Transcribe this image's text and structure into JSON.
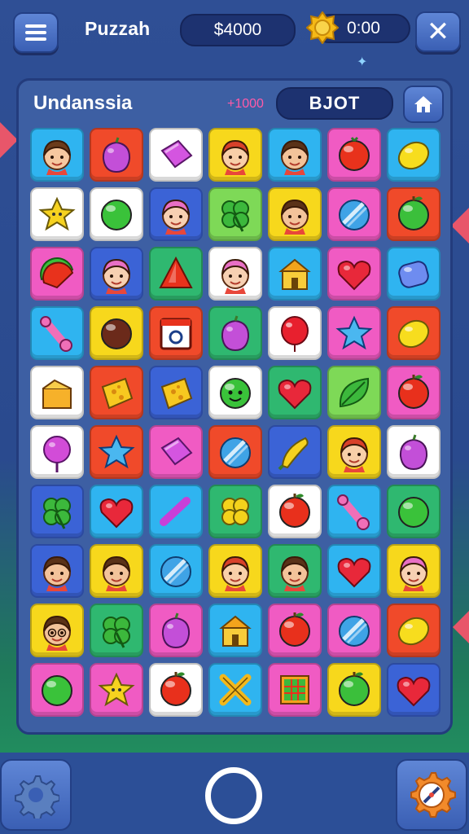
{
  "header": {
    "title": "Puzzah",
    "money": "$4000",
    "timer": "0:00"
  },
  "board": {
    "level_name": "Undanssia",
    "small_score": "+1000",
    "banner": "BJOT"
  },
  "grid": [
    [
      "face-girl",
      "plum",
      "candy-bar",
      "face-redhair",
      "face-boy",
      "tomato",
      "lemon"
    ],
    [
      "star-yellow",
      "green-ball",
      "face-pink",
      "clover",
      "face-boy",
      "blue-orb",
      "green-apple"
    ],
    [
      "watermelon",
      "face-pink",
      "triangle",
      "face-pink",
      "cheese-house",
      "heart",
      "blue-gem"
    ],
    [
      "bone",
      "brown-ball",
      "calendar",
      "plum",
      "red-balloon",
      "star-blue",
      "lemon"
    ],
    [
      "cake",
      "cheese-block",
      "cheese-block",
      "smiley-green",
      "heart",
      "leaf",
      "red-apple"
    ],
    [
      "lollipop",
      "star-blue",
      "candy-bar",
      "blue-orb",
      "corn",
      "face-redhair",
      "plum"
    ],
    [
      "clover",
      "heart",
      "check",
      "clover-yellow",
      "red-apple",
      "bone",
      "green-ball"
    ],
    [
      "face-boy",
      "face-boy",
      "blue-orb",
      "face-redhair",
      "face-boy",
      "heart",
      "face-pink"
    ],
    [
      "face-glasses",
      "clover",
      "plum",
      "cheese-house",
      "red-apple",
      "blue-orb",
      "lemon"
    ],
    [
      "green-ball",
      "star-yellow",
      "red-apple",
      "cross",
      "grid-box",
      "green-apple",
      "heart"
    ]
  ],
  "tile_colors": [
    [
      "#2fb4f0",
      "#f04a2a",
      "#ffffff",
      "#f7d81c",
      "#2fb4f0",
      "#f05bc3",
      "#2fb4f0"
    ],
    [
      "#ffffff",
      "#ffffff",
      "#3b63d6",
      "#7ed957",
      "#f7d81c",
      "#f05bc3",
      "#f04a2a"
    ],
    [
      "#f05bc3",
      "#3b63d6",
      "#2fb870",
      "#ffffff",
      "#2fb4f0",
      "#f05bc3",
      "#2fb4f0"
    ],
    [
      "#2fb4f0",
      "#f7d81c",
      "#f04a2a",
      "#2fb870",
      "#ffffff",
      "#f05bc3",
      "#f04a2a"
    ],
    [
      "#ffffff",
      "#f04a2a",
      "#3b63d6",
      "#ffffff",
      "#2fb870",
      "#7ed957",
      "#f05bc3"
    ],
    [
      "#ffffff",
      "#f04a2a",
      "#f05bc3",
      "#f04a2a",
      "#3b63d6",
      "#f7d81c",
      "#ffffff"
    ],
    [
      "#3b63d6",
      "#2fb4f0",
      "#2fb4f0",
      "#2fb870",
      "#ffffff",
      "#2fb4f0",
      "#2fb870"
    ],
    [
      "#3b63d6",
      "#f7d81c",
      "#2fb4f0",
      "#f7d81c",
      "#2fb870",
      "#2fb4f0",
      "#f7d81c"
    ],
    [
      "#f7d81c",
      "#2fb870",
      "#f05bc3",
      "#2fb4f0",
      "#f05bc3",
      "#f05bc3",
      "#f04a2a"
    ],
    [
      "#f05bc3",
      "#f05bc3",
      "#ffffff",
      "#2fb4f0",
      "#f05bc3",
      "#f7d81c",
      "#3b63d6"
    ]
  ]
}
